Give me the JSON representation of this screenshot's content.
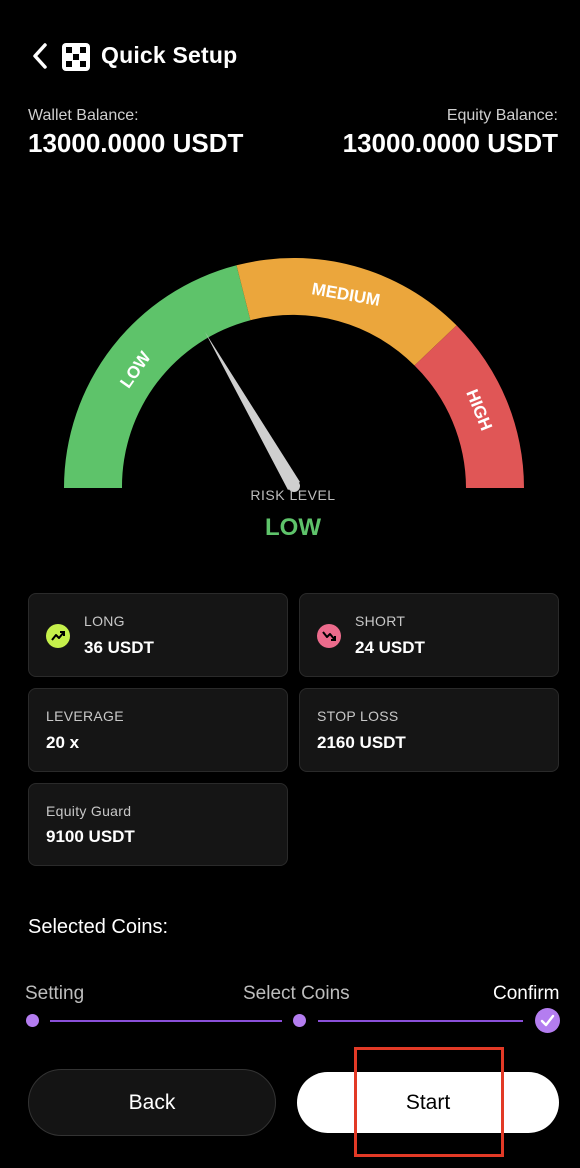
{
  "header": {
    "title": "Quick Setup",
    "back_icon": "chevron-left-icon",
    "logo_icon": "app-logo-icon"
  },
  "balances": {
    "wallet_label": "Wallet Balance:",
    "wallet_value": "13000.0000 USDT",
    "equity_label": "Equity Balance:",
    "equity_value": "13000.0000 USDT"
  },
  "gauge": {
    "segments": [
      "LOW",
      "MEDIUM",
      "HIGH"
    ],
    "colors": {
      "low": "#5ec36a",
      "medium": "#eba63c",
      "high": "#e05656"
    },
    "risk_label": "RISK LEVEL",
    "risk_value": "LOW"
  },
  "cards": {
    "long": {
      "label": "LONG",
      "value": "36 USDT",
      "icon": "trend-up-icon",
      "color": "#c5f04b"
    },
    "short": {
      "label": "SHORT",
      "value": "24 USDT",
      "icon": "trend-down-icon",
      "color": "#ec6b8c"
    },
    "leverage": {
      "label": "LEVERAGE",
      "value": "20 x"
    },
    "stop_loss": {
      "label": "STOP LOSS",
      "value": "2160 USDT"
    },
    "equity_guard": {
      "label": "Equity Guard",
      "value": "9100 USDT"
    }
  },
  "coins": {
    "title": "Selected Coins:"
  },
  "stepper": {
    "steps": [
      "Setting",
      "Select Coins",
      "Confirm"
    ],
    "active_step": "Confirm",
    "accent": "#b47df0"
  },
  "buttons": {
    "back": "Back",
    "start": "Start"
  }
}
